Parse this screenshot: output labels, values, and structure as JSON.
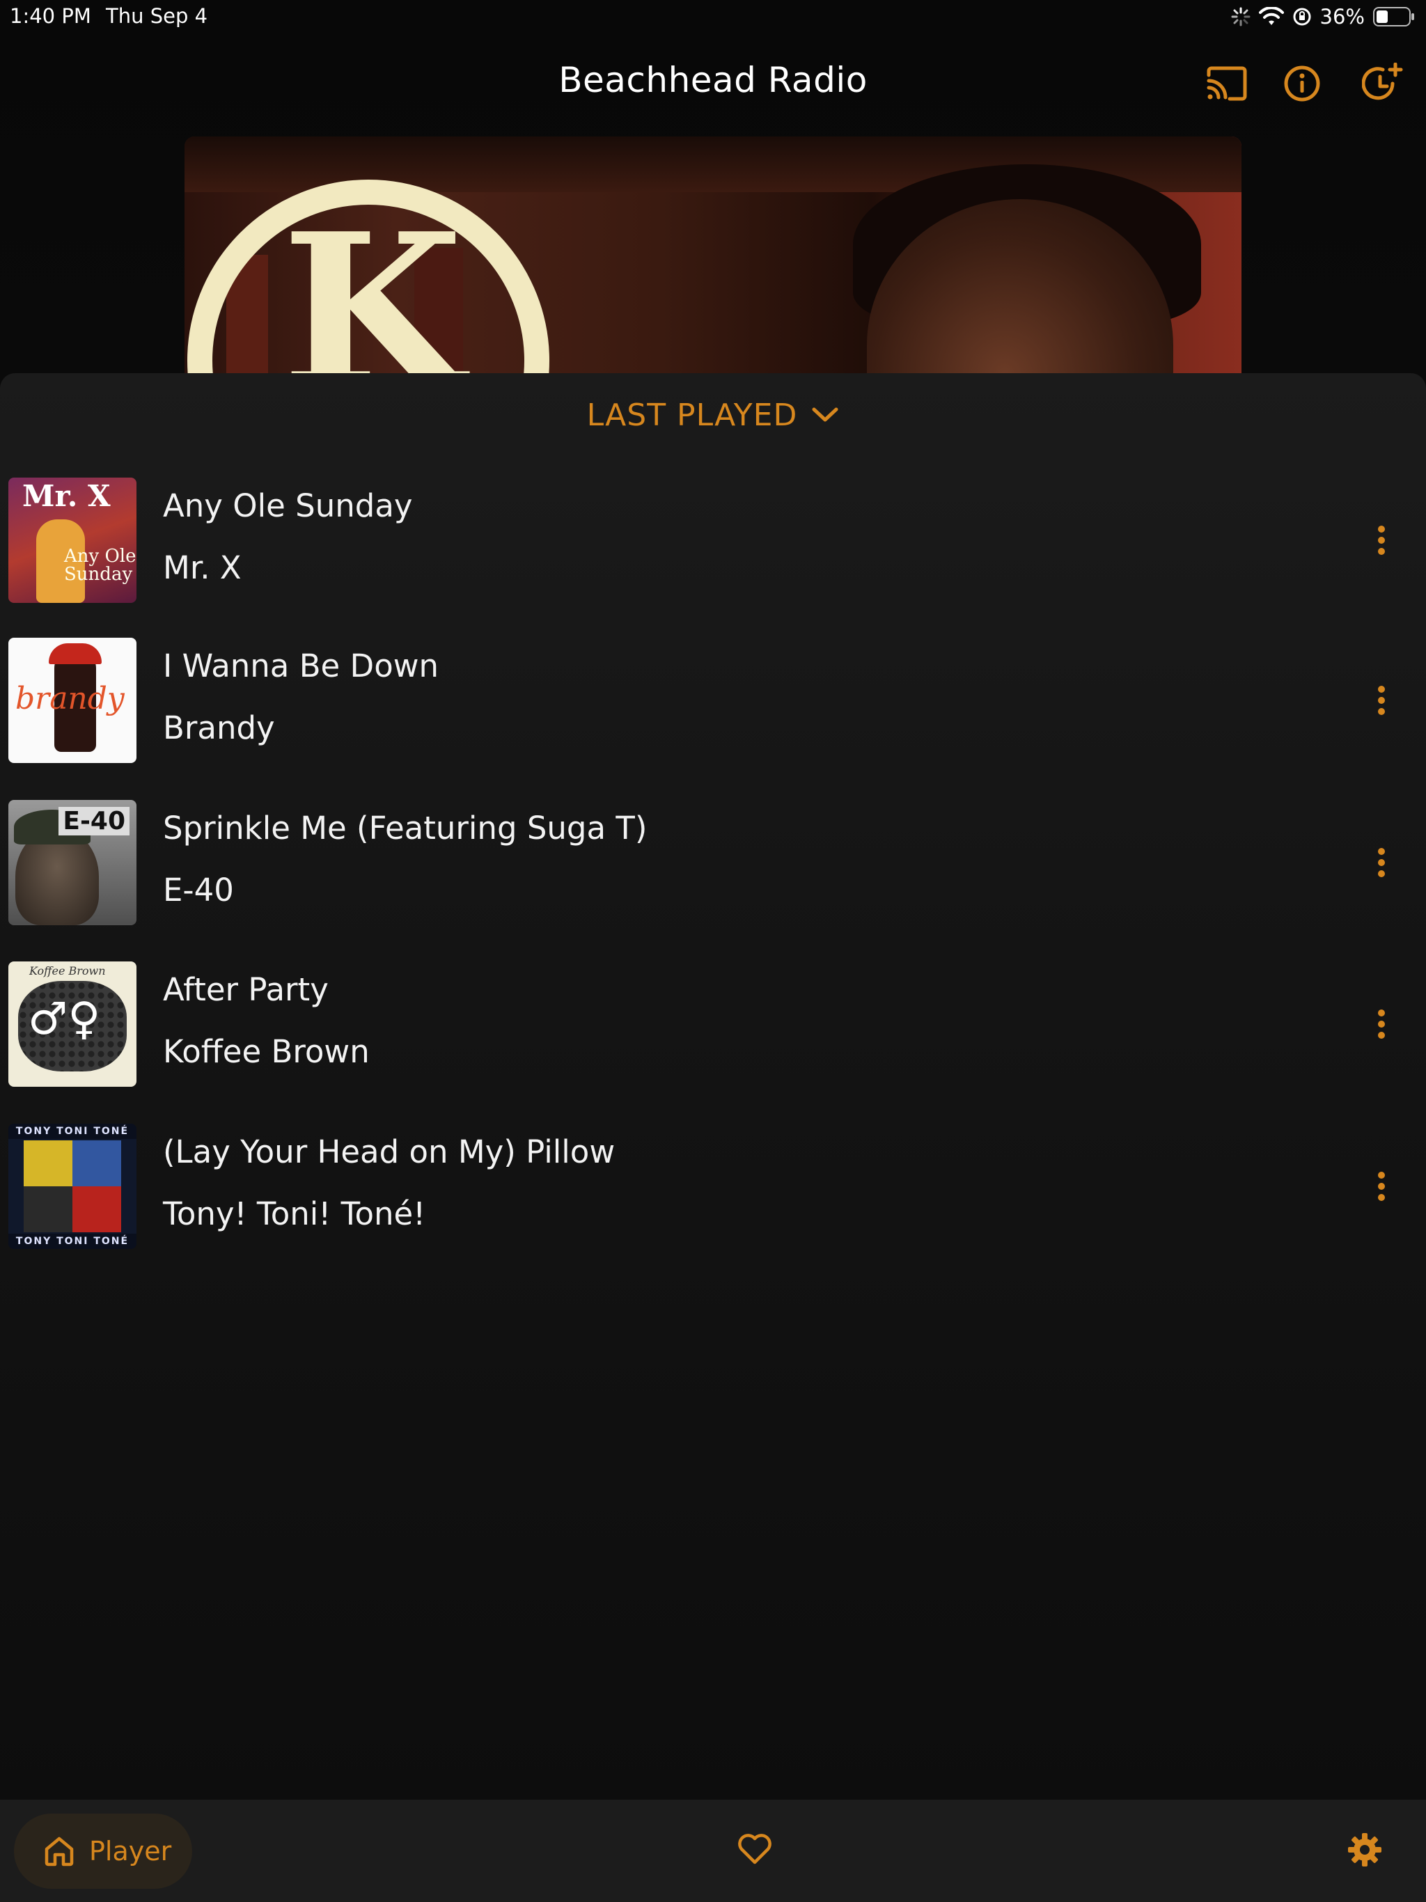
{
  "status_bar": {
    "time": "1:40 PM",
    "date": "Thu Sep 4",
    "battery_percent": "36%",
    "battery_level": 0.36,
    "icons": [
      "loading-icon",
      "wifi-icon",
      "orientation-lock-icon",
      "battery-icon"
    ]
  },
  "header": {
    "title": "Beachhead Radio",
    "icons": [
      "cast-icon",
      "info-icon",
      "timer-add-icon"
    ]
  },
  "now_playing": {
    "art_letter": "K"
  },
  "last_played": {
    "heading": "LAST PLAYED",
    "songs": [
      {
        "title": "Any Ole Sunday",
        "artist": "Mr. X",
        "art_text": "Mr. X",
        "art_subtext": "Any Ole Sunday"
      },
      {
        "title": "I Wanna Be Down",
        "artist": "Brandy",
        "art_text": "brandy"
      },
      {
        "title": "Sprinkle Me (Featuring Suga T)",
        "artist": "E-40",
        "art_text": "E-40"
      },
      {
        "title": "After Party",
        "artist": "Koffee Brown",
        "art_text": "Koffee Brown",
        "art_symbols": "♂♀"
      },
      {
        "title": "(Lay Your Head on My) Pillow",
        "artist": "Tony! Toni! Toné!",
        "art_text": "TONY TONI TONÉ"
      }
    ]
  },
  "bottom_nav": {
    "player_label": "Player",
    "icons": [
      "home-icon",
      "heart-icon",
      "gear-icon"
    ]
  },
  "colors": {
    "accent": "#d7871e",
    "background": "#0b0b0b",
    "sheet": "#1b1b1b",
    "text": "#f3f3f3"
  }
}
